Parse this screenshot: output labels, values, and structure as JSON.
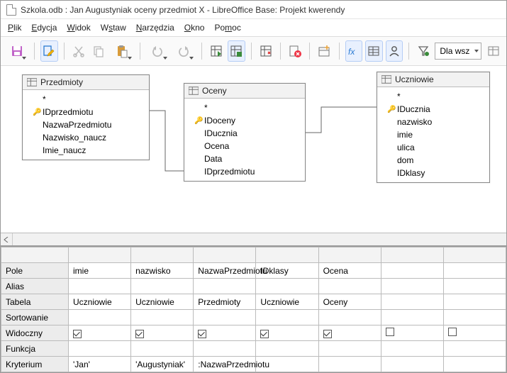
{
  "title": "Szkola.odb : Jan Augustyniak oceny przedmiot X - LibreOffice Base: Projekt kwerendy",
  "menu": {
    "plik": "Plik",
    "edycja": "Edycja",
    "widok": "Widok",
    "wstaw": "Wstaw",
    "narzedzia": "Narzędzia",
    "okno": "Okno",
    "pomoc": "Pomoc"
  },
  "toolbar": {
    "limit_label": "Dla wsz"
  },
  "tables": {
    "przedmioty": {
      "title": "Przedmioty",
      "star": "*",
      "fields": [
        {
          "key": true,
          "name": "IDprzedmiotu"
        },
        {
          "key": false,
          "name": "NazwaPrzedmiotu"
        },
        {
          "key": false,
          "name": "Nazwisko_naucz"
        },
        {
          "key": false,
          "name": "Imie_naucz"
        }
      ]
    },
    "oceny": {
      "title": "Oceny",
      "star": "*",
      "fields": [
        {
          "key": true,
          "name": "IDoceny"
        },
        {
          "key": false,
          "name": "IDucznia"
        },
        {
          "key": false,
          "name": "Ocena"
        },
        {
          "key": false,
          "name": "Data"
        },
        {
          "key": false,
          "name": "IDprzedmiotu"
        }
      ]
    },
    "uczniowie": {
      "title": "Uczniowie",
      "star": "*",
      "fields": [
        {
          "key": true,
          "name": "IDucznia"
        },
        {
          "key": false,
          "name": "nazwisko"
        },
        {
          "key": false,
          "name": "imie"
        },
        {
          "key": false,
          "name": "ulica"
        },
        {
          "key": false,
          "name": "dom"
        },
        {
          "key": false,
          "name": "IDklasy"
        }
      ]
    }
  },
  "design_grid": {
    "row_labels": {
      "pole": "Pole",
      "alias": "Alias",
      "tabela": "Tabela",
      "sortowanie": "Sortowanie",
      "widoczny": "Widoczny",
      "funkcja": "Funkcja",
      "kryterium": "Kryterium"
    },
    "columns": [
      {
        "pole": "imie",
        "alias": "",
        "tabela": "Uczniowie",
        "sort": "",
        "widoczny": true,
        "funkcja": "",
        "kryterium": "'Jan'"
      },
      {
        "pole": "nazwisko",
        "alias": "",
        "tabela": "Uczniowie",
        "sort": "",
        "widoczny": true,
        "funkcja": "",
        "kryterium": "'Augustyniak'"
      },
      {
        "pole": "NazwaPrzedmiotu",
        "alias": "",
        "tabela": "Przedmioty",
        "sort": "",
        "widoczny": true,
        "funkcja": "",
        "kryterium": ":NazwaPrzedmiotu"
      },
      {
        "pole": "IDklasy",
        "alias": "",
        "tabela": "Uczniowie",
        "sort": "",
        "widoczny": true,
        "funkcja": "",
        "kryterium": ""
      },
      {
        "pole": "Ocena",
        "alias": "",
        "tabela": "Oceny",
        "sort": "",
        "widoczny": true,
        "funkcja": "",
        "kryterium": ""
      },
      {
        "pole": "",
        "alias": "",
        "tabela": "",
        "sort": "",
        "widoczny": false,
        "funkcja": "",
        "kryterium": ""
      },
      {
        "pole": "",
        "alias": "",
        "tabela": "",
        "sort": "",
        "widoczny": false,
        "funkcja": "",
        "kryterium": ""
      }
    ]
  }
}
